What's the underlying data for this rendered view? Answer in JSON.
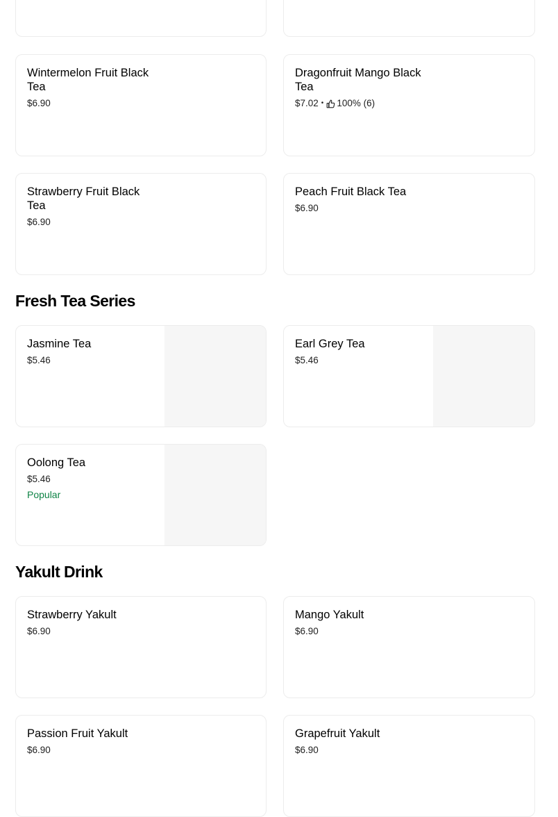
{
  "colors": {
    "popular": "#0e8345",
    "card_border": "#ececec",
    "image_placeholder": "#f6f6f6"
  },
  "top_cards": [
    {
      "name": "",
      "price": ""
    },
    {
      "name": "",
      "price": ""
    }
  ],
  "fruit_black_tea_items": [
    {
      "name": "Wintermelon Fruit Black Tea",
      "price": "$6.90"
    },
    {
      "name": "Dragonfruit Mango Black Tea",
      "price": "$7.02",
      "rating": "100% (6)",
      "rating_icon": "thumbs-up-icon"
    },
    {
      "name": "Strawberry Fruit Black Tea",
      "price": "$6.90"
    },
    {
      "name": "Peach Fruit Black Tea",
      "price": "$6.90"
    }
  ],
  "fresh_tea": {
    "title": "Fresh Tea Series",
    "items": [
      {
        "name": "Jasmine Tea",
        "price": "$5.46"
      },
      {
        "name": "Earl Grey Tea",
        "price": "$5.46"
      },
      {
        "name": "Oolong Tea",
        "price": "$5.46",
        "badge": "Popular"
      }
    ]
  },
  "yakult": {
    "title": "Yakult Drink",
    "items": [
      {
        "name": "Strawberry Yakult",
        "price": "$6.90"
      },
      {
        "name": "Mango Yakult",
        "price": "$6.90"
      },
      {
        "name": "Passion Fruit Yakult",
        "price": "$6.90"
      },
      {
        "name": "Grapefruit Yakult",
        "price": "$6.90"
      }
    ]
  }
}
